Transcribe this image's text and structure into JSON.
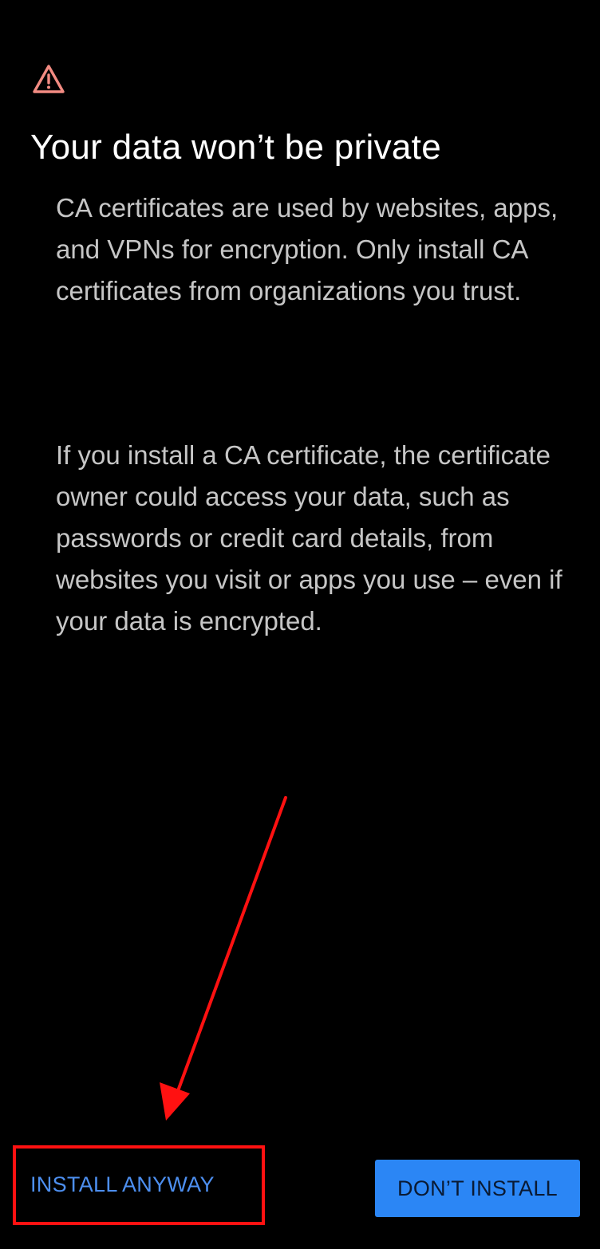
{
  "dialog": {
    "icon": "warning-triangle-icon",
    "title": "Your data won’t be private",
    "paragraph_1": "CA certificates are used by websites, apps, and VPNs for encryption. Only install CA certificates from organizations you trust.",
    "paragraph_2": "If you install a CA certificate, the certificate owner could access your data, such as passwords or credit card details, from websites you visit or apps you use – even if your data is encrypted."
  },
  "actions": {
    "install_anyway_label": "INSTALL ANYWAY",
    "dont_install_label": "DON’T INSTALL"
  },
  "colors": {
    "background": "#000000",
    "warning_icon": "#f28b82",
    "primary_button": "#2b86f5",
    "text_button": "#4d8ff0",
    "annotation": "#ff1111"
  }
}
